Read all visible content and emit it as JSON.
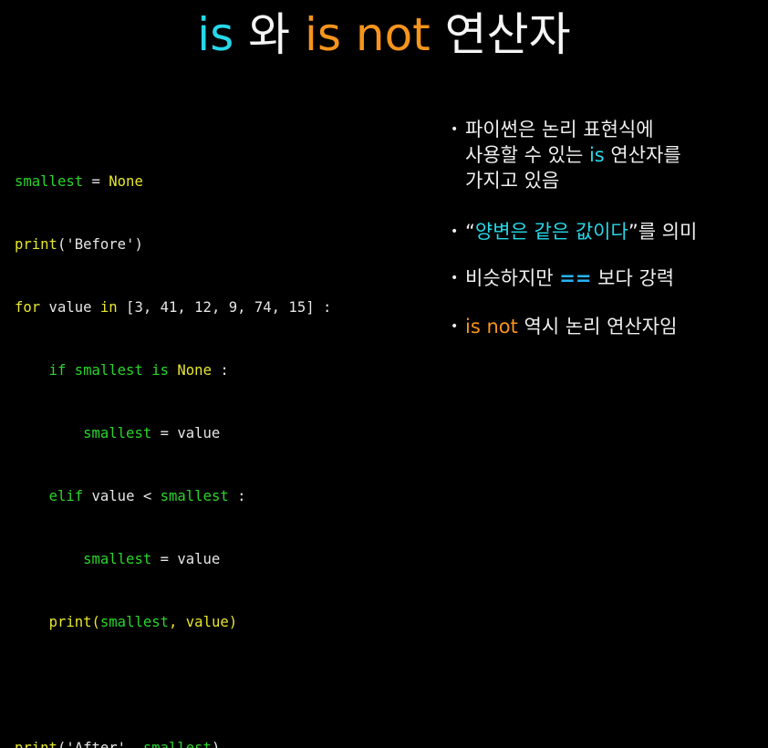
{
  "title": {
    "part1": "is",
    "part2": " 와 ",
    "part3": "is not",
    "part4": " 연산자"
  },
  "code": {
    "l1": [
      "smallest",
      " = ",
      "None"
    ],
    "l2": [
      "print",
      "('Before')"
    ],
    "l3": [
      "for",
      " value ",
      "in",
      " [3, 41, 12, 9, 74, 15] :"
    ],
    "l4": [
      "    ",
      "if",
      " smallest ",
      "is",
      " ",
      "None",
      " :"
    ],
    "l5": [
      "        ",
      "smallest",
      " = value"
    ],
    "l6": [
      "    ",
      "elif",
      " value < ",
      "smallest",
      " :"
    ],
    "l7": [
      "        ",
      "smallest",
      " = value"
    ],
    "l8": [
      "    ",
      "print",
      "(",
      "smallest",
      ", value)"
    ],
    "l10": [
      "print",
      "('After', ",
      "smallest",
      ")"
    ]
  },
  "bullets": {
    "b1_line1": "파이썬은 논리 표현식에",
    "b1_line2_pre": "사용할 수 있는 ",
    "b1_line2_is": "is",
    "b1_line2_post": " 연산자를",
    "b1_line3": "가지고 있음",
    "b2_open": "“",
    "b2_quote": "양변은 같은 값이다",
    "b2_close": "”를 의미",
    "b3_pre": "비슷하지만 ",
    "b3_op": "==",
    "b3_post": " 보다 강력",
    "b4_isnot": "is not",
    "b4_post": " 역시 논리 연산자임",
    "bullet_glyph": "•"
  },
  "colors": {
    "background": "#000000",
    "cyan": "#27d8e8",
    "orange": "#f7941d",
    "code_green": "#2bd42b",
    "code_yellow": "#e6e62e",
    "operator_blue": "#27b3f5"
  }
}
